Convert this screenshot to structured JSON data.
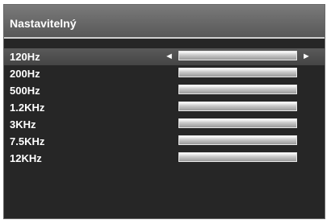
{
  "title": "Nastavitelný",
  "bands": [
    {
      "label": "120Hz",
      "level": 0.5
    },
    {
      "label": "200Hz",
      "level": 0.5
    },
    {
      "label": "500Hz",
      "level": 0.5
    },
    {
      "label": "1.2KHz",
      "level": 0.5
    },
    {
      "label": "3KHz",
      "level": 0.5
    },
    {
      "label": "7.5KHz",
      "level": 0.5
    },
    {
      "label": "12KHz",
      "level": 0.5
    }
  ],
  "selected_index": 0,
  "arrows": {
    "left": "◄",
    "right": "►"
  },
  "colors": {
    "panel": "#262626",
    "header": "#6a6a6a",
    "text": "#ffffff"
  }
}
